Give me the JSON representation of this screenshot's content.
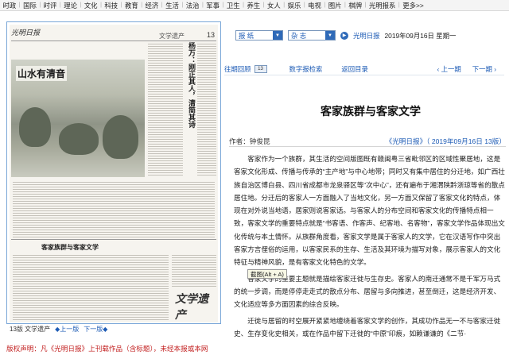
{
  "topnav": {
    "items": [
      "时政",
      "国际",
      "时评",
      "理论",
      "文化",
      "科技",
      "教育",
      "经济",
      "生活",
      "法治",
      "军事",
      "卫生",
      "养生",
      "女人",
      "娱乐",
      "电视",
      "图片",
      "棋牌",
      "光明报系",
      "更多>>"
    ]
  },
  "newspaper": {
    "masthead": "光明日报",
    "section": "文学遗产",
    "page_number": "13",
    "headline_left": "山水有清音",
    "vertical_headline": "杨万：刚正其人，清简其诗",
    "article_headline": "客家族群与客家文学",
    "section_stamp": "文学遗产"
  },
  "paper_footer": {
    "page_label": "13版 文学遗产",
    "prev": "上一版",
    "next": "下一版"
  },
  "copyright": "版权声明：凡《光明日报》上刊载作品（含标题），未经本报或本网",
  "selector": {
    "paper_value": "报  纸",
    "issue_value": "杂  志",
    "paper_name": "光明日报",
    "date_line": "2019年09月16日 星期一"
  },
  "toolbar": {
    "past_review": "往期回顾",
    "page_input": "13",
    "digital_edition": "数字报检索",
    "back_to_index": "返回目录",
    "prev_page": "上一期",
    "next_page": "下一期"
  },
  "article": {
    "title": "客家族群与客家文学",
    "author": "作者：钟俊昆",
    "source": "《光明日报》（ 2019年09月16日   13版）",
    "paragraphs": [
      "客家作为一个族群，其生活的空间版图既有赣闽粤三省毗邻区的区域性聚居地，这是客家文化形成、传播与传承的“主产地”与中心地带；同时又有集中居住的分迁地，如广西壮族自治区博白县、四川省成都市龙泉驿区等“次中心”，还有遍布于湘渭陕黔浙琼等省的散点居住地。分迁后的客家人一方面融入了当地文化，另一方面又保留了客家文化的特点，体现在对外说当地语，居家则说客家话。与客家人的分布空间和客家文化的传播特点相一致，客家文学的重要特点就是“书客语、作客声、纪客地、名客物”，客家文学作品体现出文化传统与本土情怀。从族群角度看，客家文学是属于客家人的文学，它在汉语写作中突出客家方言俚俗的运用，以客家民系的生存、生活及其环境为描写对象，展示客家人的文化特征与精神风貌，是有客家文化特色的文学。",
      "客家文学的重要主题就是描绘客家迁徙与生存史。客家人的南迁通常不是千军万马式的统一步调，而是停停走走式的散点分布、居留与多向推进，甚至倒迁，这是经济开发、文化适应等多方面因素的综合反映。",
      "迁徙与居留的时空展开紧紧地缠绕着客家文学的创作，其成功作品无一不与客家迁徙史、生存变化史相关，或在作品中留下迁徙的“中原”印痕，如赖谦谦的《二节·"
    ],
    "tooltip": "截图(Alt + A)"
  }
}
